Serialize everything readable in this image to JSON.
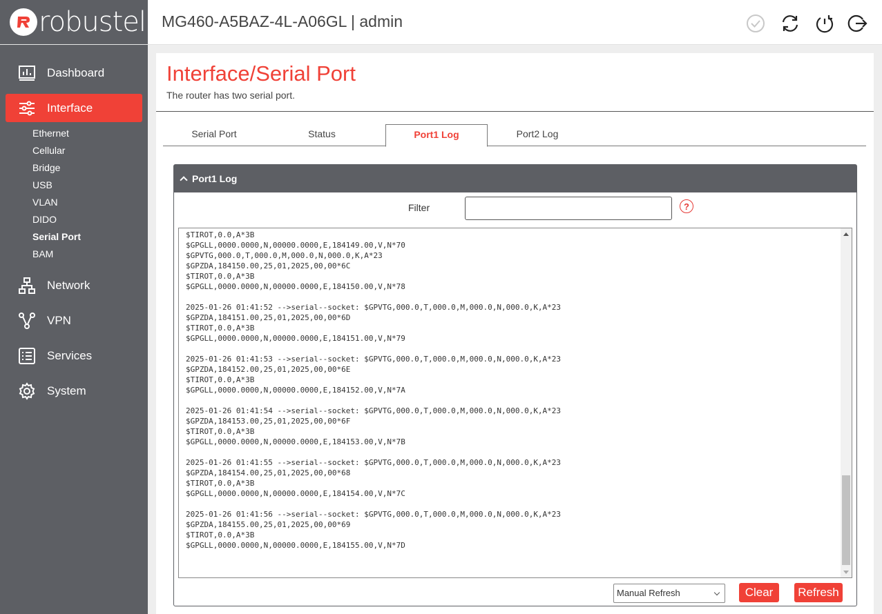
{
  "brand": {
    "logo_text": "robustel",
    "logo_glyph": "R"
  },
  "header": {
    "device_title": "MG460-A5BAZ-4L-A06GL | admin"
  },
  "sidebar": {
    "items": [
      {
        "label": "Dashboard",
        "icon": "dashboard-icon"
      },
      {
        "label": "Interface",
        "icon": "sliders-icon",
        "active": true
      },
      {
        "label": "Network",
        "icon": "network-icon"
      },
      {
        "label": "VPN",
        "icon": "vpn-icon"
      },
      {
        "label": "Services",
        "icon": "services-icon"
      },
      {
        "label": "System",
        "icon": "gear-icon"
      }
    ],
    "interface_sub": [
      "Ethernet",
      "Cellular",
      "Bridge",
      "USB",
      "VLAN",
      "DIDO",
      "Serial Port",
      "BAM"
    ],
    "active_sub": "Serial Port"
  },
  "page": {
    "title": "Interface/Serial Port",
    "description": "The router has two serial port.",
    "tabs": [
      "Serial Port",
      "Status",
      "Port1 Log",
      "Port2 Log"
    ],
    "active_tab": "Port1 Log"
  },
  "panel": {
    "title": "Port1 Log",
    "filter_label": "Filter",
    "filter_value": "",
    "help_glyph": "?",
    "log_text": "$TIROT,0.0,A*3B\n$GPGLL,0000.0000,N,00000.0000,E,184149.00,V,N*70\n$GPVTG,000.0,T,000.0,M,000.0,N,000.0,K,A*23\n$GPZDA,184150.00,25,01,2025,00,00*6C\n$TIROT,0.0,A*3B\n$GPGLL,0000.0000,N,00000.0000,E,184150.00,V,N*78\n\n2025-01-26 01:41:52 -->serial--socket: $GPVTG,000.0,T,000.0,M,000.0,N,000.0,K,A*23\n$GPZDA,184151.00,25,01,2025,00,00*6D\n$TIROT,0.0,A*3B\n$GPGLL,0000.0000,N,00000.0000,E,184151.00,V,N*79\n\n2025-01-26 01:41:53 -->serial--socket: $GPVTG,000.0,T,000.0,M,000.0,N,000.0,K,A*23\n$GPZDA,184152.00,25,01,2025,00,00*6E\n$TIROT,0.0,A*3B\n$GPGLL,0000.0000,N,00000.0000,E,184152.00,V,N*7A\n\n2025-01-26 01:41:54 -->serial--socket: $GPVTG,000.0,T,000.0,M,000.0,N,000.0,K,A*23\n$GPZDA,184153.00,25,01,2025,00,00*6F\n$TIROT,0.0,A*3B\n$GPGLL,0000.0000,N,00000.0000,E,184153.00,V,N*7B\n\n2025-01-26 01:41:55 -->serial--socket: $GPVTG,000.0,T,000.0,M,000.0,N,000.0,K,A*23\n$GPZDA,184154.00,25,01,2025,00,00*68\n$TIROT,0.0,A*3B\n$GPGLL,0000.0000,N,00000.0000,E,184154.00,V,N*7C\n\n2025-01-26 01:41:56 -->serial--socket: $GPVTG,000.0,T,000.0,M,000.0,N,000.0,K,A*23\n$GPZDA,184155.00,25,01,2025,00,00*69\n$TIROT,0.0,A*3B\n$GPGLL,0000.0000,N,00000.0000,E,184155.00,V,N*7D",
    "refresh_mode": "Manual Refresh",
    "clear_label": "Clear",
    "refresh_label": "Refresh"
  },
  "colors": {
    "accent": "#f04137",
    "sidebar_bg": "#5d5f64",
    "page_bg": "#eeeeee"
  }
}
